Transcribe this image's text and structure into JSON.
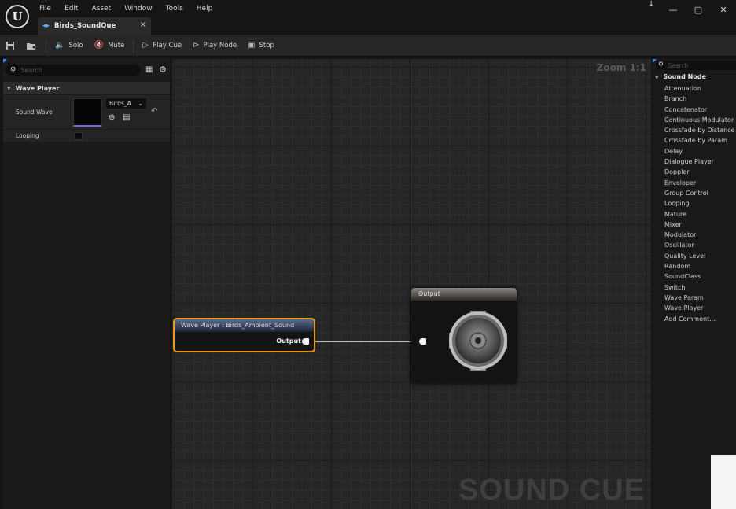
{
  "menu": [
    "File",
    "Edit",
    "Asset",
    "Window",
    "Tools",
    "Help"
  ],
  "window_controls": [
    "—",
    "▢",
    "✕"
  ],
  "tab": {
    "label": "Birds_SoundQue",
    "close": "×"
  },
  "toolbar": {
    "solo": "Solo",
    "mute": "Mute",
    "play_cue": "Play Cue",
    "play_node": "Play Node",
    "stop": "Stop"
  },
  "details": {
    "search_placeholder": "Search",
    "section": "Wave Player",
    "sound_wave_label": "Sound Wave",
    "sound_wave_value": "Birds_A",
    "looping_label": "Looping",
    "looping_checked": false
  },
  "graph": {
    "zoom": "Zoom 1:1",
    "watermark": "SOUND CUE",
    "wave_player_node": {
      "title": "Wave Player : Birds_Ambient_Sound",
      "output": "Output"
    },
    "output_node": {
      "title": "Output"
    }
  },
  "palette": {
    "search_placeholder": "Search",
    "category": "Sound Node",
    "items": [
      "Attenuation",
      "Branch",
      "Concatenator",
      "Continuous Modulator",
      "Crossfade by Distance",
      "Crossfade by Param",
      "Delay",
      "Dialogue Player",
      "Doppler",
      "Enveloper",
      "Group Control",
      "Looping",
      "Mature",
      "Mixer",
      "Modulator",
      "Oscillator",
      "Quality Level",
      "Random",
      "SoundClass",
      "Switch",
      "Wave Param",
      "Wave Player",
      "Add Comment..."
    ]
  },
  "colors": {
    "selection": "#e89a1c",
    "accent": "#3a8fff",
    "wave_underline": "#7a68e0"
  },
  "icons": {
    "engine_logo": "unreal-logo-icon",
    "save": "save-icon",
    "browse": "browse-icon",
    "solo": "solo-icon",
    "mute": "mute-icon",
    "play_cue": "play-icon",
    "play_node": "play-node-icon",
    "stop": "stop-icon",
    "speaker": "speaker-icon"
  }
}
